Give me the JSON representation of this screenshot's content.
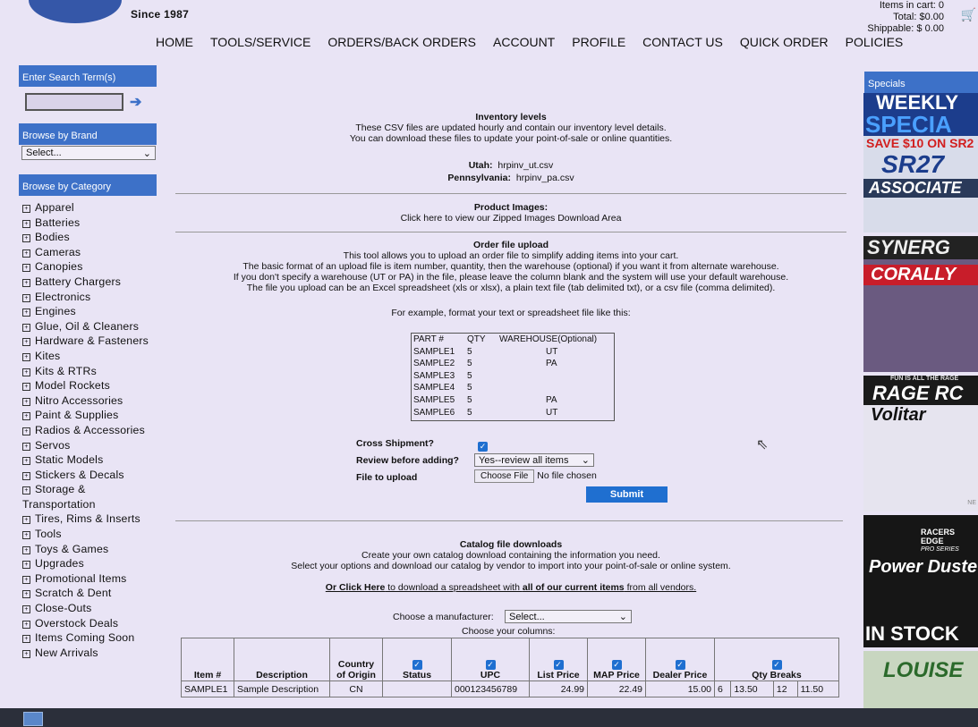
{
  "header": {
    "since": "Since 1987",
    "cart_items": "Items in cart: 0",
    "cart_total": "Total: $0.00",
    "cart_shippable": "Shippable: $ 0.00"
  },
  "nav": [
    "HOME",
    "TOOLS/SERVICE",
    "ORDERS/BACK ORDERS",
    "ACCOUNT",
    "PROFILE",
    "CONTACT US",
    "QUICK ORDER",
    "POLICIES"
  ],
  "sidebar": {
    "search_title": "Enter Search Term(s)",
    "brand_title": "Browse by Brand",
    "brand_select": "Select...",
    "category_title": "Browse by Category",
    "categories": [
      "Apparel",
      "Batteries",
      "Bodies",
      "Cameras",
      "Canopies",
      "Battery Chargers",
      "Electronics",
      "Engines",
      "Glue, Oil & Cleaners",
      "Hardware & Fasteners",
      "Kites",
      "Kits & RTRs",
      "Model Rockets",
      "Nitro Accessories",
      "Paint & Supplies",
      "Radios & Accessories",
      "Servos",
      "Static Models",
      "Stickers & Decals",
      "Storage &",
      "Tires, Rims & Inserts",
      "Tools",
      "Toys & Games",
      "Upgrades",
      "Promotional Items",
      "Scratch & Dent",
      "Close-Outs",
      "Overstock Deals",
      "Items Coming Soon",
      "New Arrivals"
    ],
    "category_continuation": "Transportation"
  },
  "inventory": {
    "title": "Inventory levels",
    "line1": "These CSV files are updated hourly and contain our inventory level details.",
    "line2": "You can download these files to update your point-of-sale or online quantities.",
    "utah_label": "Utah:",
    "utah_file": "hrpinv_ut.csv",
    "pa_label": "Pennsylvania:",
    "pa_file": "hrpinv_pa.csv"
  },
  "images": {
    "title": "Product Images:",
    "text": "Click here to view our Zipped Images Download Area"
  },
  "upload": {
    "title": "Order file upload",
    "lines": [
      "This tool allows you to upload an order file to simplify adding items into your cart.",
      "The basic format of an upload file is item number, quantity, then the warehouse (optional) if you want it from alternate warehouse.",
      "If you don't specify a warehouse (UT or PA) in the file, please leave the column blank and the system will use your default warehouse.",
      "The file you upload can be an Excel spreadsheet (xls or xlsx), a plain text file (tab delimited txt), or a csv file (comma delimited)."
    ],
    "example": "For example, format your text or spreadsheet file like this:",
    "sample_header": [
      "PART #",
      "QTY",
      "WAREHOUSE(Optional)"
    ],
    "sample_rows": [
      [
        "SAMPLE1",
        "5",
        "UT"
      ],
      [
        "SAMPLE2",
        "5",
        "PA"
      ],
      [
        "SAMPLE3",
        "5",
        ""
      ],
      [
        "SAMPLE4",
        "5",
        ""
      ],
      [
        "SAMPLE5",
        "5",
        "PA"
      ],
      [
        "SAMPLE6",
        "5",
        "UT"
      ]
    ],
    "cross_label": "Cross Shipment?",
    "review_label": "Review before adding?",
    "review_value": "Yes--review all items",
    "file_label": "File to upload",
    "choose_file": "Choose File",
    "no_file": "No file chosen",
    "submit": "Submit"
  },
  "catalog": {
    "title": "Catalog file downloads",
    "line1": "Create your own catalog download containing the information you need.",
    "line2": "Select your options and download our catalog by vendor to import into your point-of-sale or online system.",
    "link_pre": "Or Click Here",
    "link_mid1": " to download a spreadsheet with ",
    "link_bold": "all of our current items",
    "link_post": " from all vendors.",
    "manufacturer_label": "Choose a manufacturer:",
    "manufacturer_value": "Select...",
    "columns_label": "Choose your columns:",
    "columns": [
      "Item #",
      "Description",
      "Country of Origin",
      "Status",
      "UPC",
      "List Price",
      "MAP Price",
      "Dealer Price",
      "Qty Breaks"
    ],
    "row": {
      "item": "SAMPLE1",
      "desc": "Sample Description",
      "country": "CN",
      "status": "",
      "upc": "000123456789",
      "list": "24.99",
      "map": "22.49",
      "dealer": "15.00",
      "q1": "6",
      "p1": "13.50",
      "q2": "12",
      "p2": "11.50"
    }
  },
  "specials": {
    "title": "Specials",
    "ad1": [
      "WEEKLY",
      "SPECIA",
      "SAVE $10 ON SR2",
      "SR27",
      "ASSOCIATE"
    ],
    "ad2": [
      "SYNERG",
      "CORALLY"
    ],
    "ad3": [
      "FUN IS ALL THE RAGE",
      "RAGE RC",
      "Volitar",
      "NE"
    ],
    "ad4": [
      "RACERS",
      "EDGE",
      "PRO SERIES",
      "Power Duste",
      "IN STOCK"
    ],
    "ad5": [
      "LOUISE"
    ]
  }
}
